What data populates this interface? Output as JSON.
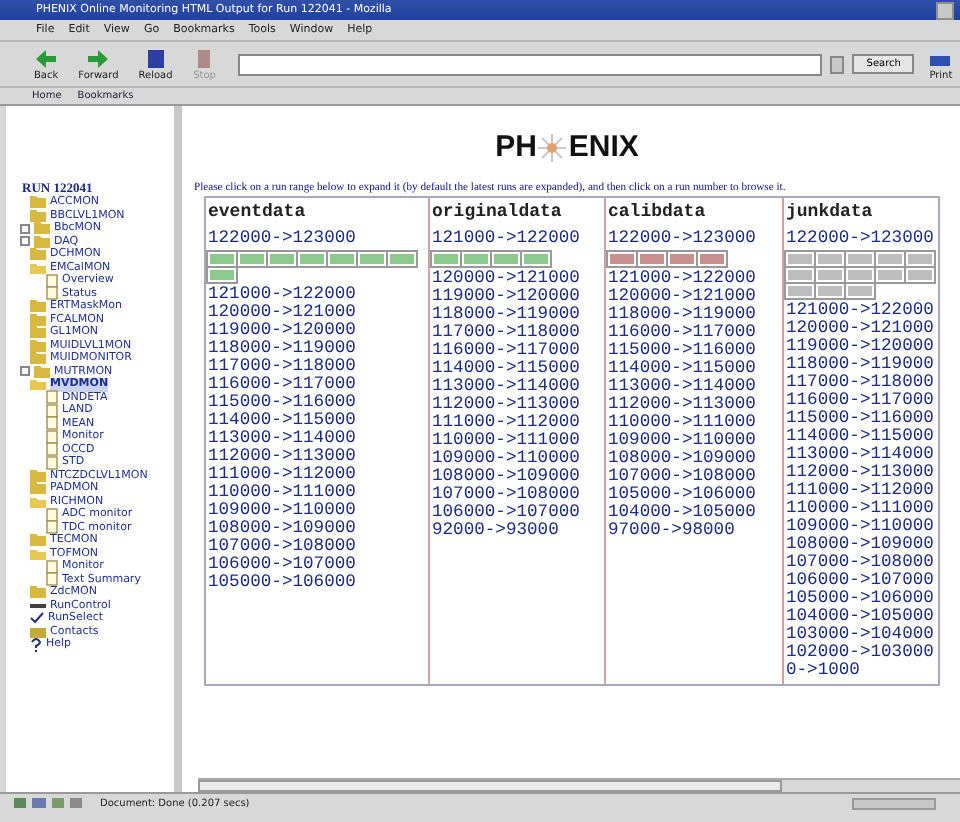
{
  "window": {
    "title": "PHENIX Online Monitoring HTML Output for Run 122041 - Mozilla"
  },
  "menu": [
    "File",
    "Edit",
    "View",
    "Go",
    "Bookmarks",
    "Tools",
    "Window",
    "Help"
  ],
  "toolbar": [
    {
      "label": "Back",
      "kind": "back",
      "disabled": false
    },
    {
      "label": "Forward",
      "kind": "forward",
      "disabled": false
    },
    {
      "label": "Reload",
      "kind": "reload",
      "disabled": false
    },
    {
      "label": "Stop",
      "kind": "stop",
      "disabled": true
    }
  ],
  "search_button": "Search",
  "print_button": "Print",
  "personal_toolbar": [
    "Home",
    "Bookmarks"
  ],
  "sidebar": {
    "root": "RUN 122041",
    "items": [
      {
        "label": "ACCMON",
        "kind": "folder",
        "selected": false
      },
      {
        "label": "BBCLVL1MON",
        "kind": "folder",
        "selected": false
      },
      {
        "label": "BbcMON",
        "kind": "folder",
        "expanded": false,
        "selected": false
      },
      {
        "label": "DAQ",
        "kind": "folder",
        "expanded": false,
        "selected": false
      },
      {
        "label": "DCHMON",
        "kind": "folder",
        "selected": false
      },
      {
        "label": "EMCalMON",
        "kind": "folder",
        "expanded": true,
        "selected": false,
        "children": [
          {
            "label": "Overview",
            "kind": "page",
            "selected": false
          },
          {
            "label": "Status",
            "kind": "page",
            "selected": false
          }
        ]
      },
      {
        "label": "ERTMaskMon",
        "kind": "folder",
        "selected": false
      },
      {
        "label": "FCALMON",
        "kind": "folder",
        "selected": false
      },
      {
        "label": "GL1MON",
        "kind": "folder",
        "selected": false
      },
      {
        "label": "MUIDLVL1MON",
        "kind": "folder",
        "selected": false
      },
      {
        "label": "MUIDMONITOR",
        "kind": "folder",
        "selected": false
      },
      {
        "label": "MUTRMON",
        "kind": "folder",
        "expanded": false,
        "selected": false
      },
      {
        "label": "MVDMON",
        "kind": "folder",
        "expanded": true,
        "selected": true,
        "children": [
          {
            "label": "DNDETA",
            "kind": "page",
            "selected": false
          },
          {
            "label": "LAND",
            "kind": "page",
            "selected": false
          },
          {
            "label": "MEAN",
            "kind": "page",
            "selected": false
          },
          {
            "label": "Monitor",
            "kind": "page",
            "selected": false
          },
          {
            "label": "OCCD",
            "kind": "page",
            "selected": false
          },
          {
            "label": "STD",
            "kind": "page",
            "selected": false
          }
        ]
      },
      {
        "label": "NTCZDCLVL1MON",
        "kind": "folder",
        "selected": false
      },
      {
        "label": "PADMON",
        "kind": "folder",
        "selected": false
      },
      {
        "label": "RICHMON",
        "kind": "folder",
        "expanded": true,
        "selected": false,
        "children": [
          {
            "label": "ADC monitor",
            "kind": "page",
            "selected": false
          },
          {
            "label": "TDC monitor",
            "kind": "page",
            "selected": false
          }
        ]
      },
      {
        "label": "TECMON",
        "kind": "folder",
        "selected": false
      },
      {
        "label": "TOFMON",
        "kind": "folder",
        "expanded": true,
        "selected": false,
        "children": [
          {
            "label": "Monitor",
            "kind": "page",
            "selected": false
          },
          {
            "label": "Text Summary",
            "kind": "page",
            "selected": false
          }
        ]
      },
      {
        "label": "ZdcMON",
        "kind": "folder",
        "selected": false
      },
      {
        "label": "RunControl",
        "kind": "control",
        "selected": false
      },
      {
        "label": "RunSelect",
        "kind": "check",
        "selected": false
      },
      {
        "label": "Contacts",
        "kind": "contacts",
        "selected": false
      },
      {
        "label": "Help",
        "kind": "help",
        "selected": false
      }
    ]
  },
  "page": {
    "logo": {
      "left": "PH",
      "right": "ENIX"
    },
    "instructions": "Please click on a run range below to expand it (by default the latest runs are expanded), and then click on a run number to browse it.",
    "columns": [
      {
        "name": "eventdata",
        "color": "#8cc98c",
        "ranges": [
          {
            "label": "122000->123000",
            "chips": [
              {
                "kind": "run"
              },
              {
                "kind": "run"
              },
              {
                "kind": "run"
              },
              {
                "kind": "run"
              },
              {
                "kind": "run"
              },
              {
                "kind": "run"
              },
              {
                "kind": "run"
              },
              {
                "kind": "run"
              }
            ]
          },
          {
            "label": "121000->122000"
          },
          {
            "label": "120000->121000"
          },
          {
            "label": "119000->120000"
          },
          {
            "label": "118000->119000"
          },
          {
            "label": "117000->118000"
          },
          {
            "label": "116000->117000"
          },
          {
            "label": "115000->116000"
          },
          {
            "label": "114000->115000"
          },
          {
            "label": "113000->114000"
          },
          {
            "label": "112000->113000"
          },
          {
            "label": "111000->112000"
          },
          {
            "label": "110000->111000"
          },
          {
            "label": "109000->110000"
          },
          {
            "label": "108000->109000"
          },
          {
            "label": "107000->108000"
          },
          {
            "label": "106000->107000"
          },
          {
            "label": "105000->106000"
          }
        ]
      },
      {
        "name": "originaldata",
        "color": "#8cc98c",
        "ranges": [
          {
            "label": "121000->122000",
            "chips": [
              {
                "kind": "run"
              },
              {
                "kind": "run"
              },
              {
                "kind": "run"
              },
              {
                "kind": "run"
              }
            ]
          },
          {
            "label": "120000->121000"
          },
          {
            "label": "119000->120000"
          },
          {
            "label": "118000->119000"
          },
          {
            "label": "117000->118000"
          },
          {
            "label": "116000->117000"
          },
          {
            "label": "114000->115000"
          },
          {
            "label": "113000->114000"
          },
          {
            "label": "112000->113000"
          },
          {
            "label": "111000->112000"
          },
          {
            "label": "110000->111000"
          },
          {
            "label": "109000->110000"
          },
          {
            "label": "108000->109000"
          },
          {
            "label": "107000->108000"
          },
          {
            "label": "106000->107000"
          },
          {
            "label": "92000->93000"
          }
        ]
      },
      {
        "name": "calibdata",
        "color": "#c99090",
        "ranges": [
          {
            "label": "122000->123000",
            "chips": [
              {
                "kind": "run"
              },
              {
                "kind": "run"
              },
              {
                "kind": "run"
              },
              {
                "kind": "run"
              }
            ]
          },
          {
            "label": "121000->122000"
          },
          {
            "label": "120000->121000"
          },
          {
            "label": "118000->119000"
          },
          {
            "label": "116000->117000"
          },
          {
            "label": "115000->116000"
          },
          {
            "label": "114000->115000"
          },
          {
            "label": "113000->114000"
          },
          {
            "label": "112000->113000"
          },
          {
            "label": "110000->111000"
          },
          {
            "label": "109000->110000"
          },
          {
            "label": "108000->109000"
          },
          {
            "label": "107000->108000"
          },
          {
            "label": "105000->106000"
          },
          {
            "label": "104000->105000"
          },
          {
            "label": "97000->98000"
          }
        ]
      },
      {
        "name": "junkdata",
        "color": "#bdbdbd",
        "ranges": [
          {
            "label": "122000->123000",
            "chips": [
              {
                "kind": "run"
              },
              {
                "kind": "run"
              },
              {
                "kind": "run"
              },
              {
                "kind": "run"
              },
              {
                "kind": "run"
              },
              {
                "kind": "run"
              },
              {
                "kind": "run"
              },
              {
                "kind": "run"
              },
              {
                "kind": "run"
              },
              {
                "kind": "run"
              },
              {
                "kind": "run"
              },
              {
                "kind": "run"
              },
              {
                "kind": "run"
              }
            ]
          },
          {
            "label": "121000->122000"
          },
          {
            "label": "120000->121000"
          },
          {
            "label": "119000->120000"
          },
          {
            "label": "118000->119000"
          },
          {
            "label": "117000->118000"
          },
          {
            "label": "116000->117000"
          },
          {
            "label": "115000->116000"
          },
          {
            "label": "114000->115000"
          },
          {
            "label": "113000->114000"
          },
          {
            "label": "112000->113000"
          },
          {
            "label": "111000->112000"
          },
          {
            "label": "110000->111000"
          },
          {
            "label": "109000->110000"
          },
          {
            "label": "108000->109000"
          },
          {
            "label": "107000->108000"
          },
          {
            "label": "106000->107000"
          },
          {
            "label": "105000->106000"
          },
          {
            "label": "104000->105000"
          },
          {
            "label": "103000->104000"
          },
          {
            "label": "102000->103000"
          },
          {
            "label": "0->1000"
          }
        ]
      }
    ]
  },
  "status_bar": {
    "text": "Document: Done (0.207 secs)"
  }
}
